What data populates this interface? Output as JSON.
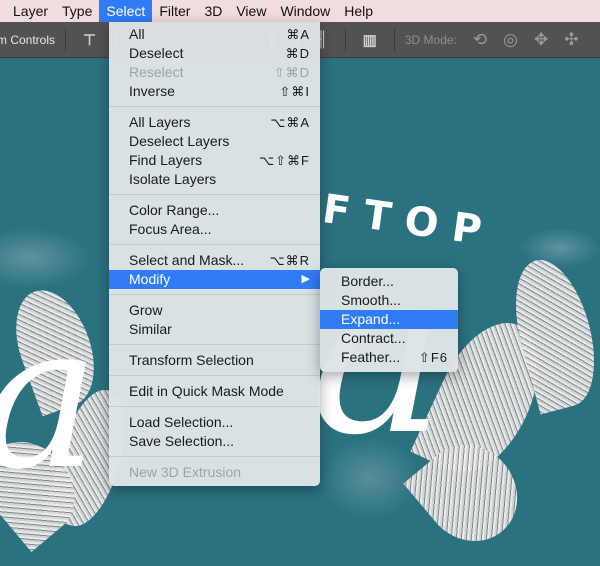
{
  "menubar": {
    "items": [
      "Layer",
      "Type",
      "Select",
      "Filter",
      "3D",
      "View",
      "Window",
      "Help"
    ],
    "active": "Select"
  },
  "toolbar": {
    "label": "m Controls",
    "mode_label": "3D Mode:",
    "align_icons": [
      "align-top-icon",
      "align-vcenter-icon",
      "align-bottom-icon",
      "distribute-left-icon",
      "distribute-hcenter-icon",
      "distribute-right-icon",
      "auto-align-icon"
    ],
    "mode_icons": [
      "orbit-icon",
      "roll-icon",
      "pan-icon",
      "slide-icon"
    ]
  },
  "canvas": {
    "headline": "FTOP",
    "script_text": "a"
  },
  "select_menu": {
    "groups": [
      [
        {
          "label": "All",
          "shortcut": "⌘A",
          "disabled": false
        },
        {
          "label": "Deselect",
          "shortcut": "⌘D",
          "disabled": false
        },
        {
          "label": "Reselect",
          "shortcut": "⇧⌘D",
          "disabled": true
        },
        {
          "label": "Inverse",
          "shortcut": "⇧⌘I",
          "disabled": false
        }
      ],
      [
        {
          "label": "All Layers",
          "shortcut": "⌥⌘A",
          "disabled": false
        },
        {
          "label": "Deselect Layers",
          "shortcut": "",
          "disabled": false
        },
        {
          "label": "Find Layers",
          "shortcut": "⌥⇧⌘F",
          "disabled": false
        },
        {
          "label": "Isolate Layers",
          "shortcut": "",
          "disabled": false
        }
      ],
      [
        {
          "label": "Color Range...",
          "shortcut": "",
          "disabled": false
        },
        {
          "label": "Focus Area...",
          "shortcut": "",
          "disabled": false
        }
      ],
      [
        {
          "label": "Select and Mask...",
          "shortcut": "⌥⌘R",
          "disabled": false
        },
        {
          "label": "Modify",
          "shortcut": "▶",
          "disabled": false,
          "highlighted": true,
          "submenu": true
        }
      ],
      [
        {
          "label": "Grow",
          "shortcut": "",
          "disabled": false
        },
        {
          "label": "Similar",
          "shortcut": "",
          "disabled": false
        }
      ],
      [
        {
          "label": "Transform Selection",
          "shortcut": "",
          "disabled": false
        }
      ],
      [
        {
          "label": "Edit in Quick Mask Mode",
          "shortcut": "",
          "disabled": false
        }
      ],
      [
        {
          "label": "Load Selection...",
          "shortcut": "",
          "disabled": false
        },
        {
          "label": "Save Selection...",
          "shortcut": "",
          "disabled": false
        }
      ],
      [
        {
          "label": "New 3D Extrusion",
          "shortcut": "",
          "disabled": true
        }
      ]
    ]
  },
  "modify_submenu": {
    "items": [
      {
        "label": "Border...",
        "shortcut": ""
      },
      {
        "label": "Smooth...",
        "shortcut": ""
      },
      {
        "label": "Expand...",
        "shortcut": "",
        "highlighted": true
      },
      {
        "label": "Contract...",
        "shortcut": ""
      },
      {
        "label": "Feather...",
        "shortcut": "⇧F6"
      }
    ]
  },
  "colors": {
    "highlight": "#2f7cf6",
    "menubar_bg": "#f1dcdf",
    "toolbar_bg": "#525252",
    "canvas_bg": "#2b7280"
  }
}
